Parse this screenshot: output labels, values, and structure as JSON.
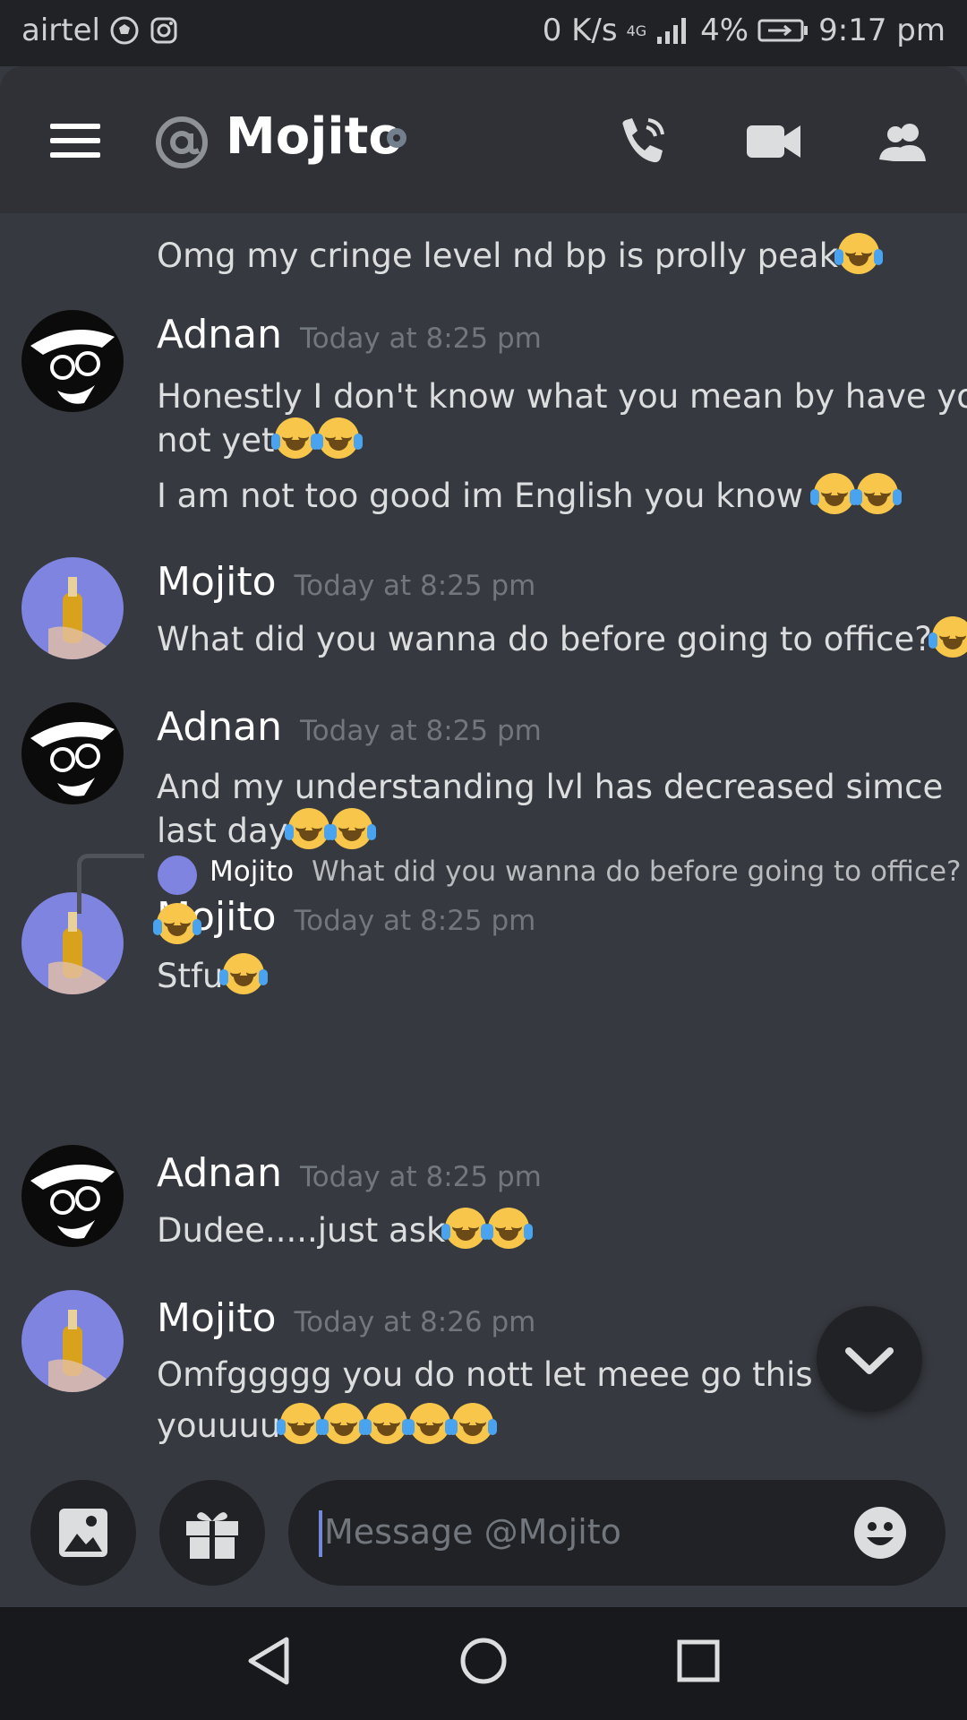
{
  "status_bar": {
    "carrier": "airtel",
    "net_speed": "0 K/s",
    "network": "4G",
    "battery": "4%",
    "time": "9:17 pm",
    "icons": [
      "soccer-ball-icon",
      "instagram-icon",
      "signal-icon",
      "battery-charging-icon"
    ]
  },
  "header": {
    "channel_name": "Mojito",
    "icons": [
      "menu-icon",
      "at-icon",
      "status-offline-icon",
      "voice-call-icon",
      "video-call-icon",
      "members-icon"
    ]
  },
  "messages": [
    {
      "author": "",
      "time": "",
      "lines": [
        {
          "text": "Omg my cringe level nd bp is prolly peak",
          "emoji": 1
        }
      ]
    },
    {
      "author": "Adnan",
      "time": "Today at 8:25 pm",
      "lines": [
        {
          "text": "Honestly I don't know what you mean by have you",
          "emoji": 0
        },
        {
          "text": "not yet",
          "emoji": 2
        },
        {
          "text": "I am not too good im English you know ",
          "emoji": 2
        }
      ]
    },
    {
      "author": "Mojito",
      "time": "Today at 8:25 pm",
      "lines": [
        {
          "text": "What did you wanna do before going to office?",
          "emoji": 1
        }
      ]
    },
    {
      "author": "Adnan",
      "time": "Today at 8:25 pm",
      "lines": [
        {
          "text": "And my understanding lvl has decreased simce",
          "emoji": 0
        },
        {
          "text": "last day",
          "emoji": 2
        }
      ]
    },
    {
      "author": "Mojito",
      "time": "Today at 8:25 pm",
      "lines": [
        {
          "text": "Stfu",
          "emoji": 1
        }
      ]
    },
    {
      "author": "Adnan",
      "time": "Today at 8:25 pm",
      "reply": {
        "author": "Mojito",
        "text": "What did you wanna do before going to office?"
      },
      "lines": [
        {
          "text": "Dudee.....just ask",
          "emoji": 2
        }
      ]
    },
    {
      "author": "Mojito",
      "time": "Today at 8:26 pm",
      "lines": [
        {
          "text": "Omfggggg you do nott let meee go this way",
          "emoji": 0
        },
        {
          "text": "youuuu",
          "emoji": 5
        }
      ]
    }
  ],
  "composer": {
    "placeholder": "Message @Mojito",
    "icons": [
      "image-icon",
      "gift-icon",
      "emoji-icon"
    ]
  },
  "nav": {
    "icons": [
      "back-icon",
      "home-icon",
      "recents-icon"
    ]
  },
  "colors": {
    "background": "#36393f",
    "header": "#2f3136",
    "input": "#202225",
    "accent": "#7289da"
  }
}
